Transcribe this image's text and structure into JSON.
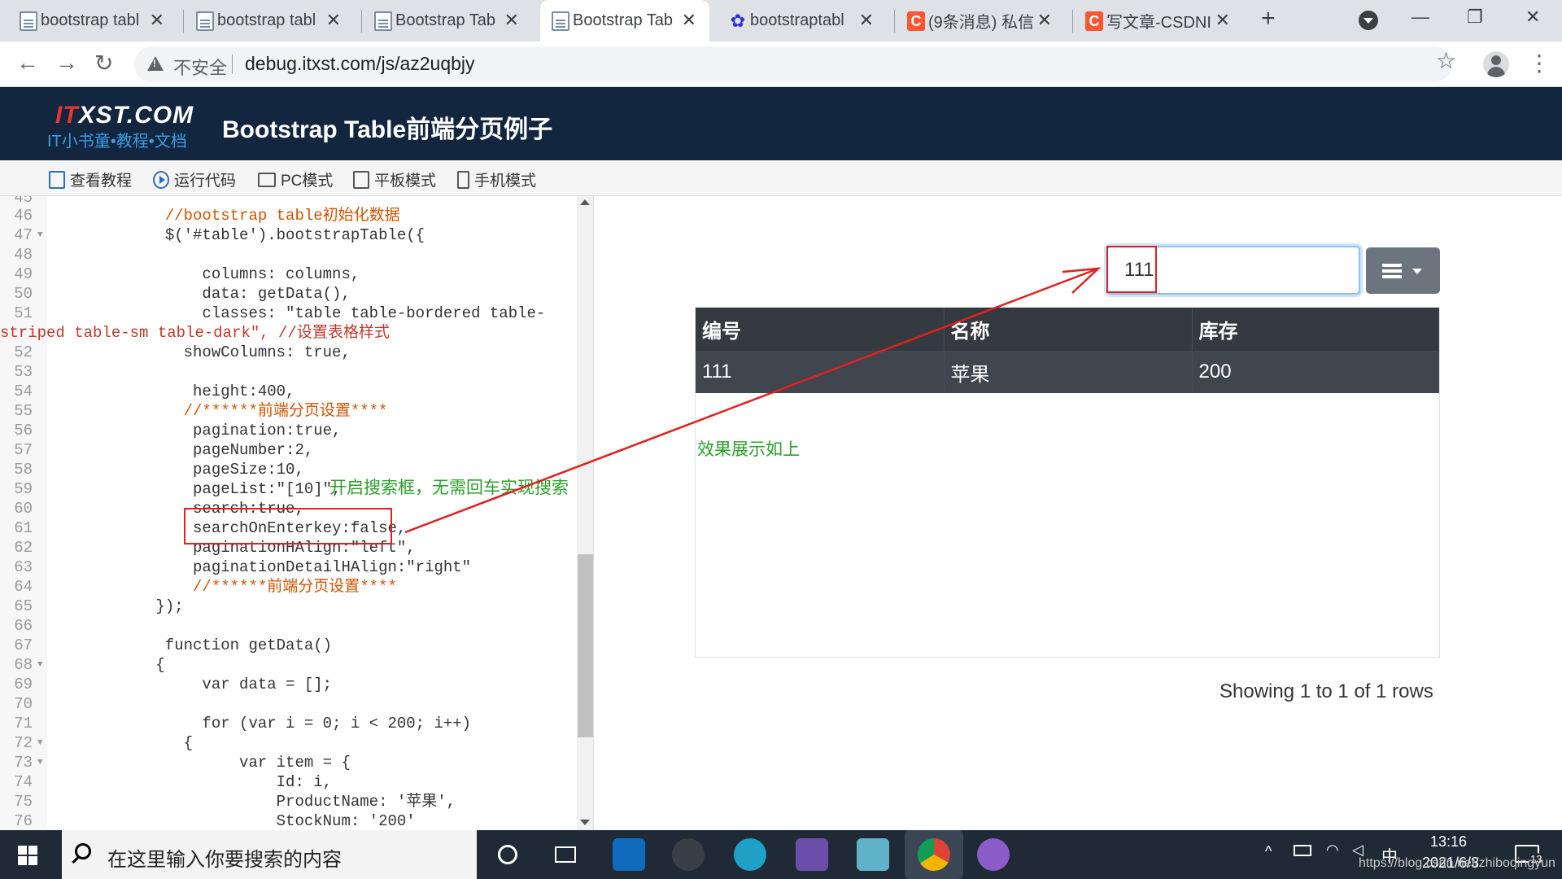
{
  "browser": {
    "tabs": [
      {
        "title": "bootstrap tabl",
        "favicon": "doc"
      },
      {
        "title": "bootstrap tabl",
        "favicon": "doc"
      },
      {
        "title": "Bootstrap Tab",
        "favicon": "doc"
      },
      {
        "title": "Bootstrap Tab",
        "favicon": "doc"
      },
      {
        "title": "bootstraptabl",
        "favicon": "baidu"
      },
      {
        "title": "(9条消息) 私信",
        "favicon": "csdn"
      },
      {
        "title": "写文章-CSDNI",
        "favicon": "csdn"
      }
    ],
    "active_tab_index": 3,
    "close_glyph": "✕",
    "newtab_glyph": "+",
    "security_label": "不安全",
    "url": "debug.itxst.com/js/az2uqbjy",
    "window_controls": {
      "minimize": "—",
      "restore": "❐",
      "close": "✕"
    }
  },
  "site": {
    "logo_it": "IT",
    "logo_rest": "XST.COM",
    "logo_sub": "IT小书童•教程•文档",
    "title": "Bootstrap Table前端分页例子",
    "menu": [
      "查看教程",
      "运行代码",
      "PC模式",
      "平板模式",
      "手机模式"
    ]
  },
  "editor": {
    "first_partial_line": "45",
    "lines": [
      {
        "n": "46",
        "fold": false,
        "code": "            //bootstrap table初始化数据"
      },
      {
        "n": "47",
        "fold": true,
        "code": "            $('#table').bootstrapTable({"
      },
      {
        "n": "48",
        "fold": false,
        "code": ""
      },
      {
        "n": "49",
        "fold": false,
        "code": "                columns: columns,"
      },
      {
        "n": "50",
        "fold": false,
        "code": "                data: getData(),"
      },
      {
        "n": "51",
        "fold": false,
        "code": "                classes: \"table table-bordered table-"
      },
      {
        "n": "",
        "fold": false,
        "code": "striped table-sm table-dark\", //设置表格样式"
      },
      {
        "n": "52",
        "fold": false,
        "code": "              showColumns: true,"
      },
      {
        "n": "53",
        "fold": false,
        "code": ""
      },
      {
        "n": "54",
        "fold": false,
        "code": "               height:400,"
      },
      {
        "n": "55",
        "fold": false,
        "code": "              //******前端分页设置****"
      },
      {
        "n": "56",
        "fold": false,
        "code": "               pagination:true,"
      },
      {
        "n": "57",
        "fold": false,
        "code": "               pageNumber:2,"
      },
      {
        "n": "58",
        "fold": false,
        "code": "               pageSize:10,"
      },
      {
        "n": "59",
        "fold": false,
        "code": "               pageList:\"[10]\","
      },
      {
        "n": "60",
        "fold": false,
        "code": "               search:true,"
      },
      {
        "n": "61",
        "fold": false,
        "code": "               searchOnEnterkey:false,"
      },
      {
        "n": "62",
        "fold": false,
        "code": "               paginationHAlign:\"left\","
      },
      {
        "n": "63",
        "fold": false,
        "code": "               paginationDetailHAlign:\"right\""
      },
      {
        "n": "64",
        "fold": false,
        "code": "               //******前端分页设置****"
      },
      {
        "n": "65",
        "fold": false,
        "code": "           });"
      },
      {
        "n": "66",
        "fold": false,
        "code": ""
      },
      {
        "n": "67",
        "fold": false,
        "code": "            function getData()"
      },
      {
        "n": "68",
        "fold": true,
        "code": "           {"
      },
      {
        "n": "69",
        "fold": false,
        "code": "                var data = [];"
      },
      {
        "n": "70",
        "fold": false,
        "code": ""
      },
      {
        "n": "71",
        "fold": false,
        "code": "                for (var i = 0; i < 200; i++)"
      },
      {
        "n": "72",
        "fold": true,
        "code": "              {"
      },
      {
        "n": "73",
        "fold": true,
        "code": "                    var item = {"
      },
      {
        "n": "74",
        "fold": false,
        "code": "                        Id: i,"
      },
      {
        "n": "75",
        "fold": false,
        "code": "                        ProductName: '苹果',"
      },
      {
        "n": "76",
        "fold": false,
        "code": "                        StockNum: '200'"
      }
    ],
    "annotation": "开启搜索框，无需回车实现搜索"
  },
  "preview": {
    "search_value": "111",
    "columns": [
      "编号",
      "名称",
      "库存"
    ],
    "rows": [
      [
        "111",
        "苹果",
        "200"
      ]
    ],
    "effect_note": "效果展示如上",
    "pagination_info": "Showing 1 to 1 of 1 rows"
  },
  "taskbar": {
    "search_placeholder": "在这里输入你要搜索的内容",
    "ime": "中",
    "time": "13:16",
    "date": "2021/6/3",
    "notification_count": "13",
    "watermark": "https://blog.csdn.net/zhiboqingyun"
  },
  "colors": {
    "header_bg": "#13263f",
    "table_dark": "#343a40",
    "annotation_green": "#2aa02a",
    "annotation_red": "#e02020"
  }
}
